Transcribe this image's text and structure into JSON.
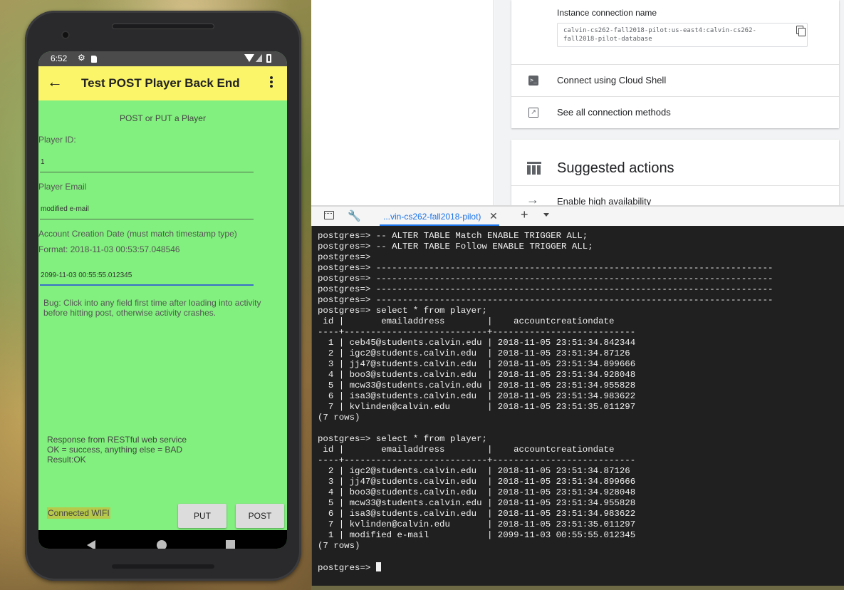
{
  "phone": {
    "status": {
      "time": "6:52"
    },
    "app_bar": {
      "title": "Test POST Player Back End"
    },
    "form": {
      "subtitle": "POST or PUT a Player",
      "player_id_label": "Player ID:",
      "player_id_value": "1",
      "email_label": "Player Email",
      "email_value": "modified e-mail",
      "date_label": "Account Creation Date (must match timestamp type)",
      "format_label": "Format: 2018-11-03 00:53:57.048546",
      "date_value": "2099-11-03 00:55:55.012345",
      "bug_note": "Bug: Click into any field first time after loading into activity before hitting post, otherwise activity crashes.",
      "response_lines": [
        "Response from RESTful web service",
        "OK = success, anything else = BAD",
        "Result:OK"
      ],
      "connection_status": "Connected WIFI",
      "put_label": "PUT",
      "post_label": "POST"
    }
  },
  "console": {
    "instance_connection_label": "Instance connection name",
    "instance_connection_value": "calvin-cs262-fall2018-pilot:us-east4:calvin-cs262-fall2018-pilot-database",
    "connect_cloud_shell": "Connect using Cloud Shell",
    "see_all_methods": "See all connection methods",
    "suggested_title": "Suggested actions",
    "enable_ha": "Enable high availability"
  },
  "terminal": {
    "tab_label": "...vin-cs262-fall2018-pilot)",
    "lines": [
      "postgres=> -- ALTER TABLE Match ENABLE TRIGGER ALL;",
      "postgres=> -- ALTER TABLE Follow ENABLE TRIGGER ALL;",
      "postgres=>",
      "postgres=> ---------------------------------------------------------------------------",
      "postgres=> ---------------------------------------------------------------------------",
      "postgres=> ---------------------------------------------------------------------------",
      "postgres=> ---------------------------------------------------------------------------",
      "postgres=> select * from player;",
      " id |       emailaddress        |    accountcreationdate",
      "----+---------------------------+---------------------------",
      "  1 | ceb45@students.calvin.edu | 2018-11-05 23:51:34.842344",
      "  2 | igc2@students.calvin.edu  | 2018-11-05 23:51:34.87126",
      "  3 | jj47@students.calvin.edu  | 2018-11-05 23:51:34.899666",
      "  4 | boo3@students.calvin.edu  | 2018-11-05 23:51:34.928048",
      "  5 | mcw33@students.calvin.edu | 2018-11-05 23:51:34.955828",
      "  6 | isa3@students.calvin.edu  | 2018-11-05 23:51:34.983622",
      "  7 | kvlinden@calvin.edu       | 2018-11-05 23:51:35.011297",
      "(7 rows)",
      "",
      "postgres=> select * from player;",
      " id |       emailaddress        |    accountcreationdate",
      "----+---------------------------+---------------------------",
      "  2 | igc2@students.calvin.edu  | 2018-11-05 23:51:34.87126",
      "  3 | jj47@students.calvin.edu  | 2018-11-05 23:51:34.899666",
      "  4 | boo3@students.calvin.edu  | 2018-11-05 23:51:34.928048",
      "  5 | mcw33@students.calvin.edu | 2018-11-05 23:51:34.955828",
      "  6 | isa3@students.calvin.edu  | 2018-11-05 23:51:34.983622",
      "  7 | kvlinden@calvin.edu       | 2018-11-05 23:51:35.011297",
      "  1 | modified e-mail           | 2099-11-03 00:55:55.012345",
      "(7 rows)",
      ""
    ],
    "prompt": "postgres=> "
  }
}
